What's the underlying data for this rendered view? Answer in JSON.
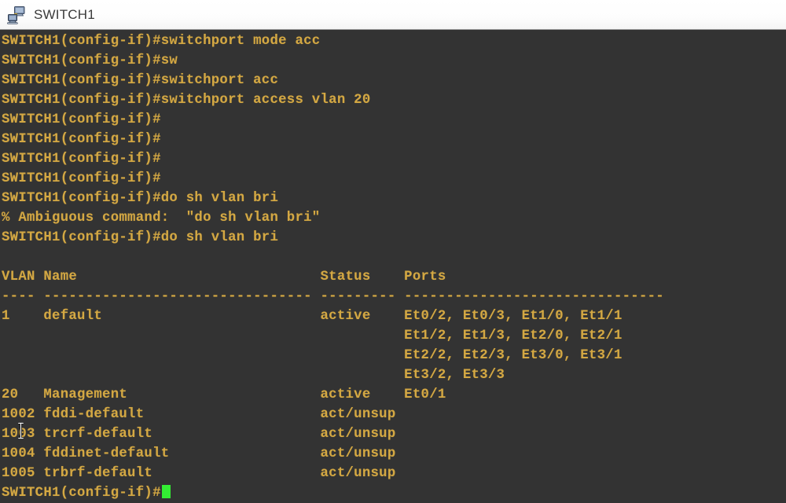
{
  "window": {
    "title": "SWITCH1",
    "icon": "network-switch-icon",
    "titlebar_bg": "#ffffff",
    "title_color": "#3a3a3a"
  },
  "terminal": {
    "background_color": "#333333",
    "text_color": "#d4a843",
    "cursor_color": "#33ee33",
    "prompt": "SWITCH1(config-if)#",
    "mouse_cursor": "i-beam-text-cursor",
    "lines": [
      "SWITCH1(config-if)#switchport mode acc",
      "SWITCH1(config-if)#sw",
      "SWITCH1(config-if)#switchport acc",
      "SWITCH1(config-if)#switchport access vlan 20",
      "SWITCH1(config-if)#",
      "SWITCH1(config-if)#",
      "SWITCH1(config-if)#",
      "SWITCH1(config-if)#",
      "SWITCH1(config-if)#do sh vlan bri",
      "% Ambiguous command:  \"do sh vlan bri\"",
      "SWITCH1(config-if)#do sh vlan bri",
      "",
      "VLAN Name                             Status    Ports",
      "---- -------------------------------- --------- -------------------------------",
      "1    default                          active    Et0/2, Et0/3, Et1/0, Et1/1",
      "                                                Et1/2, Et1/3, Et2/0, Et2/1",
      "                                                Et2/2, Et2/3, Et3/0, Et3/1",
      "                                                Et3/2, Et3/3",
      "20   Management                       active    Et0/1",
      "1002 fddi-default                     act/unsup",
      "1003 trcrf-default                    act/unsup",
      "1004 fddinet-default                  act/unsup",
      "1005 trbrf-default                    act/unsup"
    ],
    "last_prompt": "SWITCH1(config-if)#"
  },
  "vlan_table": {
    "headers": [
      "VLAN",
      "Name",
      "Status",
      "Ports"
    ],
    "rows": [
      {
        "vlan": "1",
        "name": "default",
        "status": "active",
        "ports": "Et0/2, Et0/3, Et1/0, Et1/1, Et1/2, Et1/3, Et2/0, Et2/1, Et2/2, Et2/3, Et3/0, Et3/1, Et3/2, Et3/3"
      },
      {
        "vlan": "20",
        "name": "Management",
        "status": "active",
        "ports": "Et0/1"
      },
      {
        "vlan": "1002",
        "name": "fddi-default",
        "status": "act/unsup",
        "ports": ""
      },
      {
        "vlan": "1003",
        "name": "trcrf-default",
        "status": "act/unsup",
        "ports": ""
      },
      {
        "vlan": "1004",
        "name": "fddinet-default",
        "status": "act/unsup",
        "ports": ""
      },
      {
        "vlan": "1005",
        "name": "trbrf-default",
        "status": "act/unsup",
        "ports": ""
      }
    ]
  }
}
